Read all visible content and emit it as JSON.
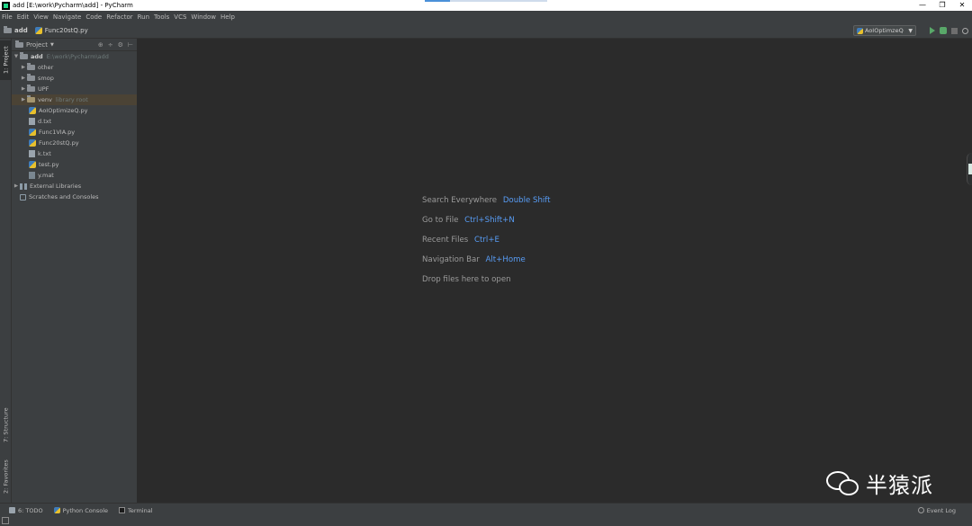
{
  "window": {
    "title": "add [E:\\work\\Pycharm\\add] - PyCharm",
    "controls": [
      "—",
      "❐",
      "✕"
    ]
  },
  "menu": [
    "File",
    "Edit",
    "View",
    "Navigate",
    "Code",
    "Refactor",
    "Run",
    "Tools",
    "VCS",
    "Window",
    "Help"
  ],
  "navbar": {
    "project": "add",
    "file": "Func20stQ.py",
    "run_config": "AoIOptimzeQ"
  },
  "left_strip": {
    "project_tab": "1: Project",
    "structure_tab": "7: Structure",
    "favorites_tab": "2: Favorites"
  },
  "project_panel": {
    "title": "Project",
    "root": {
      "name": "add",
      "path": "E:\\work\\Pycharm\\add"
    },
    "folders": [
      "other",
      "smop",
      "UPF"
    ],
    "venv": {
      "name": "venv",
      "hint": "library root"
    },
    "files": [
      {
        "name": "AoIOptimizeQ.py",
        "kind": "py"
      },
      {
        "name": "d.txt",
        "kind": "txt"
      },
      {
        "name": "Func1VIA.py",
        "kind": "py"
      },
      {
        "name": "Func20stQ.py",
        "kind": "py"
      },
      {
        "name": "k.txt",
        "kind": "txt"
      },
      {
        "name": "test.py",
        "kind": "py"
      },
      {
        "name": "y.mat",
        "kind": "mat"
      }
    ],
    "external_libraries": "External Libraries",
    "scratches": "Scratches and Consoles"
  },
  "editor_tips": [
    {
      "label": "Search Everywhere",
      "shortcut": "Double Shift"
    },
    {
      "label": "Go to File",
      "shortcut": "Ctrl+Shift+N"
    },
    {
      "label": "Recent Files",
      "shortcut": "Ctrl+E"
    },
    {
      "label": "Navigation Bar",
      "shortcut": "Alt+Home"
    },
    {
      "label": "Drop files here to open",
      "shortcut": ""
    }
  ],
  "watermark": "半猿派",
  "statusbar": {
    "todo": "6: TODO",
    "python_console": "Python Console",
    "terminal": "Terminal",
    "event_log": "Event Log"
  },
  "colors": {
    "background": "#2b2b2b",
    "panel": "#3c3f41",
    "shortcut": "#589df6",
    "run_green": "#59a869",
    "selection": "#4b4335"
  }
}
